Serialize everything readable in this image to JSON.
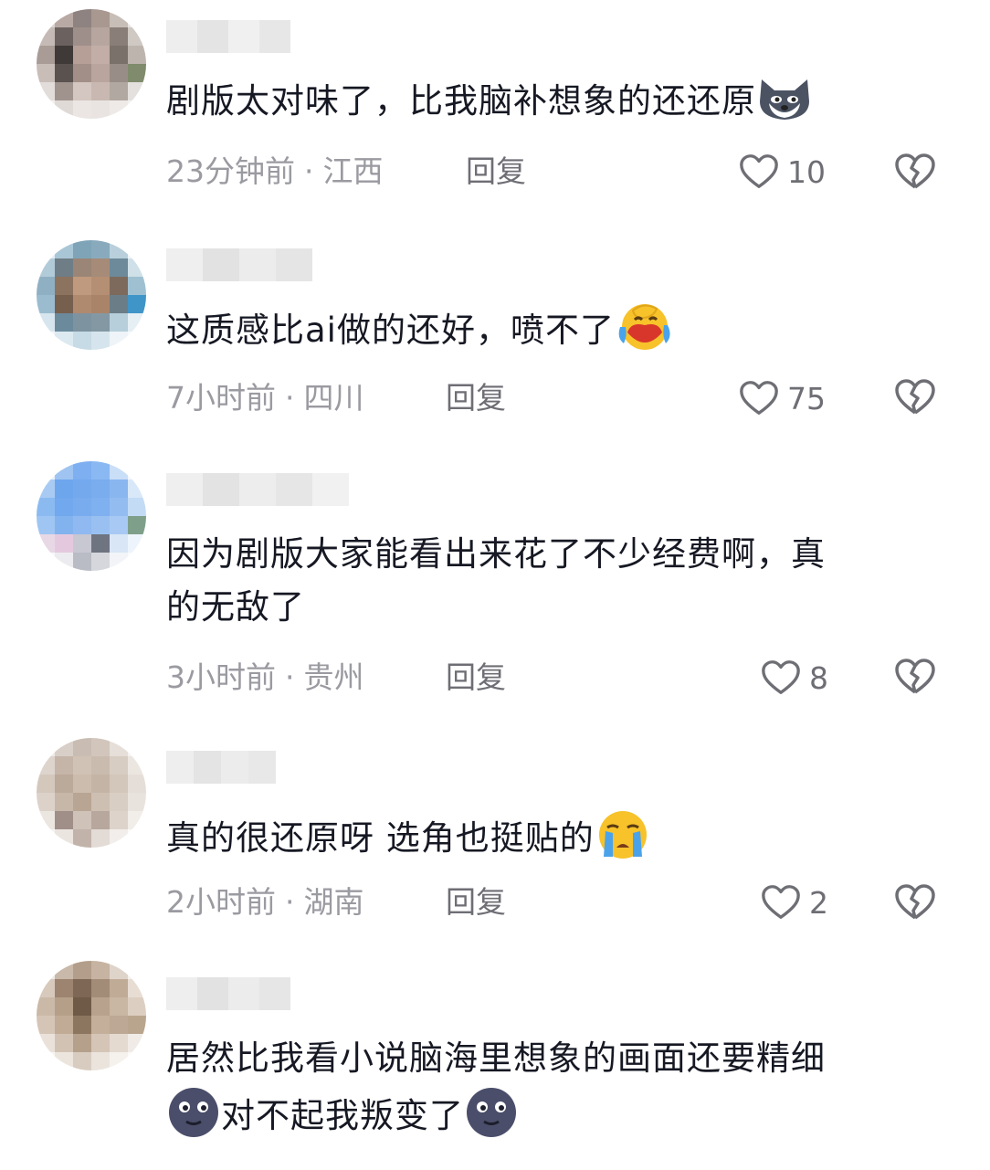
{
  "comments": [
    {
      "text": "剧版太对味了，比我脑补想象的还还原",
      "time": "23分钟前",
      "location": "江西",
      "reply": "回复",
      "likes": "10",
      "emoji_after": "wolf-dog-emoji"
    },
    {
      "text": "这质感比ai做的还好，喷不了",
      "time": "7小时前",
      "location": "四川",
      "reply": "回复",
      "likes": "75",
      "emoji_after": "laughing-crying-emoji"
    },
    {
      "text": "因为剧版大家能看出来花了不少经费啊，真",
      "text2": "的无敌了",
      "time": "3小时前",
      "location": "贵州",
      "reply": "回复",
      "likes": "8"
    },
    {
      "text": "真的很还原呀 选角也挺贴的",
      "time": "2小时前",
      "location": "湖南",
      "reply": "回复",
      "likes": "2",
      "emoji_after": "crying-emoji"
    },
    {
      "text": "居然比我看小说脑海里想象的画面还要精细",
      "text2": "对不起我叛变了",
      "emoji_before_line2": "dark-moon-face-emoji",
      "emoji_after_line2": "dark-moon-face-emoji"
    }
  ],
  "colors": {
    "text": "#161823",
    "meta": "#9a9aa1",
    "action": "#6e6e75"
  }
}
